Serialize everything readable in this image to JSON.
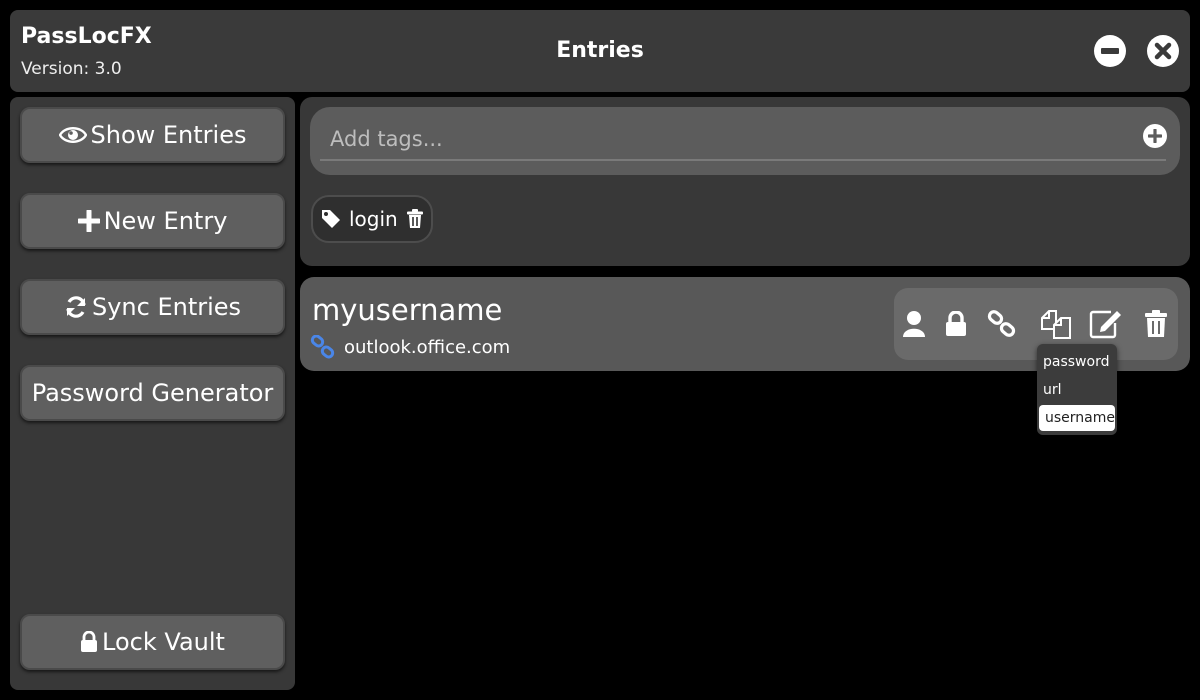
{
  "app": {
    "name": "PassLocFX",
    "version": "Version: 3.0"
  },
  "header": {
    "title": "Entries"
  },
  "window_controls": {
    "minimize_icon": "minus-circle-icon",
    "close_icon": "times-circle-icon"
  },
  "sidebar": {
    "items": [
      {
        "label": "Show Entries",
        "icon": "eye-icon"
      },
      {
        "label": "New Entry",
        "icon": "plus-icon"
      },
      {
        "label": "Sync Entries",
        "icon": "sync-icon"
      },
      {
        "label": "Password Generator",
        "icon": ""
      }
    ],
    "lock": {
      "label": "Lock Vault",
      "icon": "lock-icon"
    }
  },
  "tags": {
    "input_placeholder": "Add tags...",
    "input_value": "",
    "add_icon": "plus-circle-icon",
    "items": [
      {
        "label": "login",
        "icon": "tag-icon",
        "remove_icon": "trash-icon"
      }
    ]
  },
  "entry": {
    "username": "myusername",
    "url": "outlook.office.com",
    "url_icon": "link-icon",
    "actions": [
      "user-icon",
      "lock-icon",
      "link-icon",
      "copy-icon",
      "edit-icon",
      "trash-icon"
    ]
  },
  "copy_menu": {
    "options": [
      "password",
      "url",
      "username"
    ],
    "selected": "username"
  },
  "colors": {
    "background": "#000000",
    "panel": "#383838",
    "button": "#5f5f5f",
    "card": "#585858",
    "link_icon": "#4a86e8"
  }
}
